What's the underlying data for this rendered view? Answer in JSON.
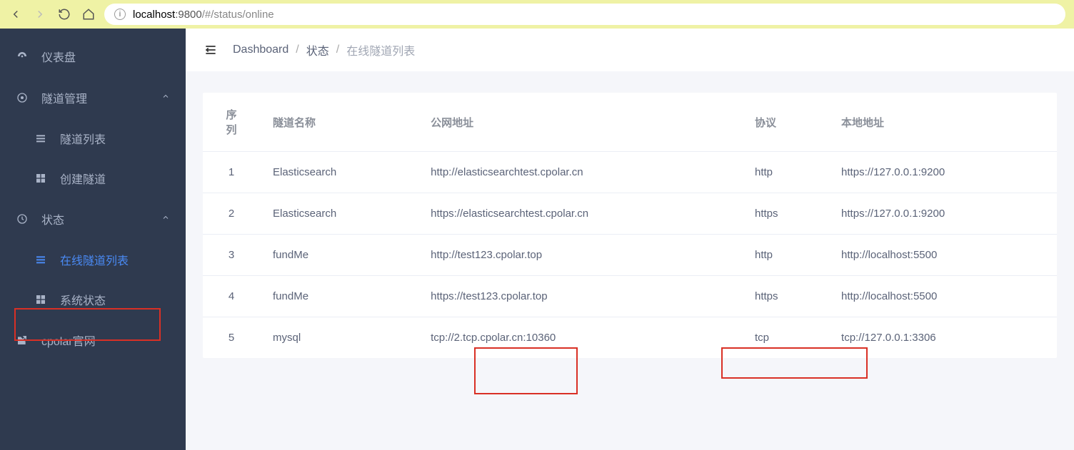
{
  "browser": {
    "url_host": "localhost",
    "url_port": ":9800",
    "url_path": "/#/status/online"
  },
  "sidebar": {
    "items": [
      {
        "label": "仪表盘",
        "icon": "dashboard-icon"
      },
      {
        "label": "隧道管理",
        "icon": "target-icon",
        "expandable": true
      },
      {
        "label": "隧道列表",
        "icon": "list-icon",
        "sub": true
      },
      {
        "label": "创建隧道",
        "icon": "grid-icon",
        "sub": true
      },
      {
        "label": "状态",
        "icon": "status-icon",
        "expandable": true
      },
      {
        "label": "在线隧道列表",
        "icon": "table-icon",
        "sub": true,
        "active": true
      },
      {
        "label": "系统状态",
        "icon": "grid-icon",
        "sub": true
      },
      {
        "label": "cpolar官网",
        "icon": "external-icon"
      }
    ]
  },
  "breadcrumb": {
    "root": "Dashboard",
    "mid": "状态",
    "current": "在线隧道列表"
  },
  "table": {
    "headers": {
      "seq": "序列",
      "name": "隧道名称",
      "public": "公网地址",
      "proto": "协议",
      "local": "本地地址"
    },
    "rows": [
      {
        "seq": "1",
        "name": "Elasticsearch",
        "public": "http://elasticsearchtest.cpolar.cn",
        "proto": "http",
        "local": "https://127.0.0.1:9200"
      },
      {
        "seq": "2",
        "name": "Elasticsearch",
        "public": "https://elasticsearchtest.cpolar.cn",
        "proto": "https",
        "local": "https://127.0.0.1:9200"
      },
      {
        "seq": "3",
        "name": "fundMe",
        "public": "http://test123.cpolar.top",
        "proto": "http",
        "local": "http://localhost:5500"
      },
      {
        "seq": "4",
        "name": "fundMe",
        "public": "https://test123.cpolar.top",
        "proto": "https",
        "local": "http://localhost:5500"
      },
      {
        "seq": "5",
        "name": "mysql",
        "public": "tcp://2.tcp.cpolar.cn:10360",
        "proto": "tcp",
        "local": "tcp://127.0.0.1:3306"
      }
    ]
  }
}
